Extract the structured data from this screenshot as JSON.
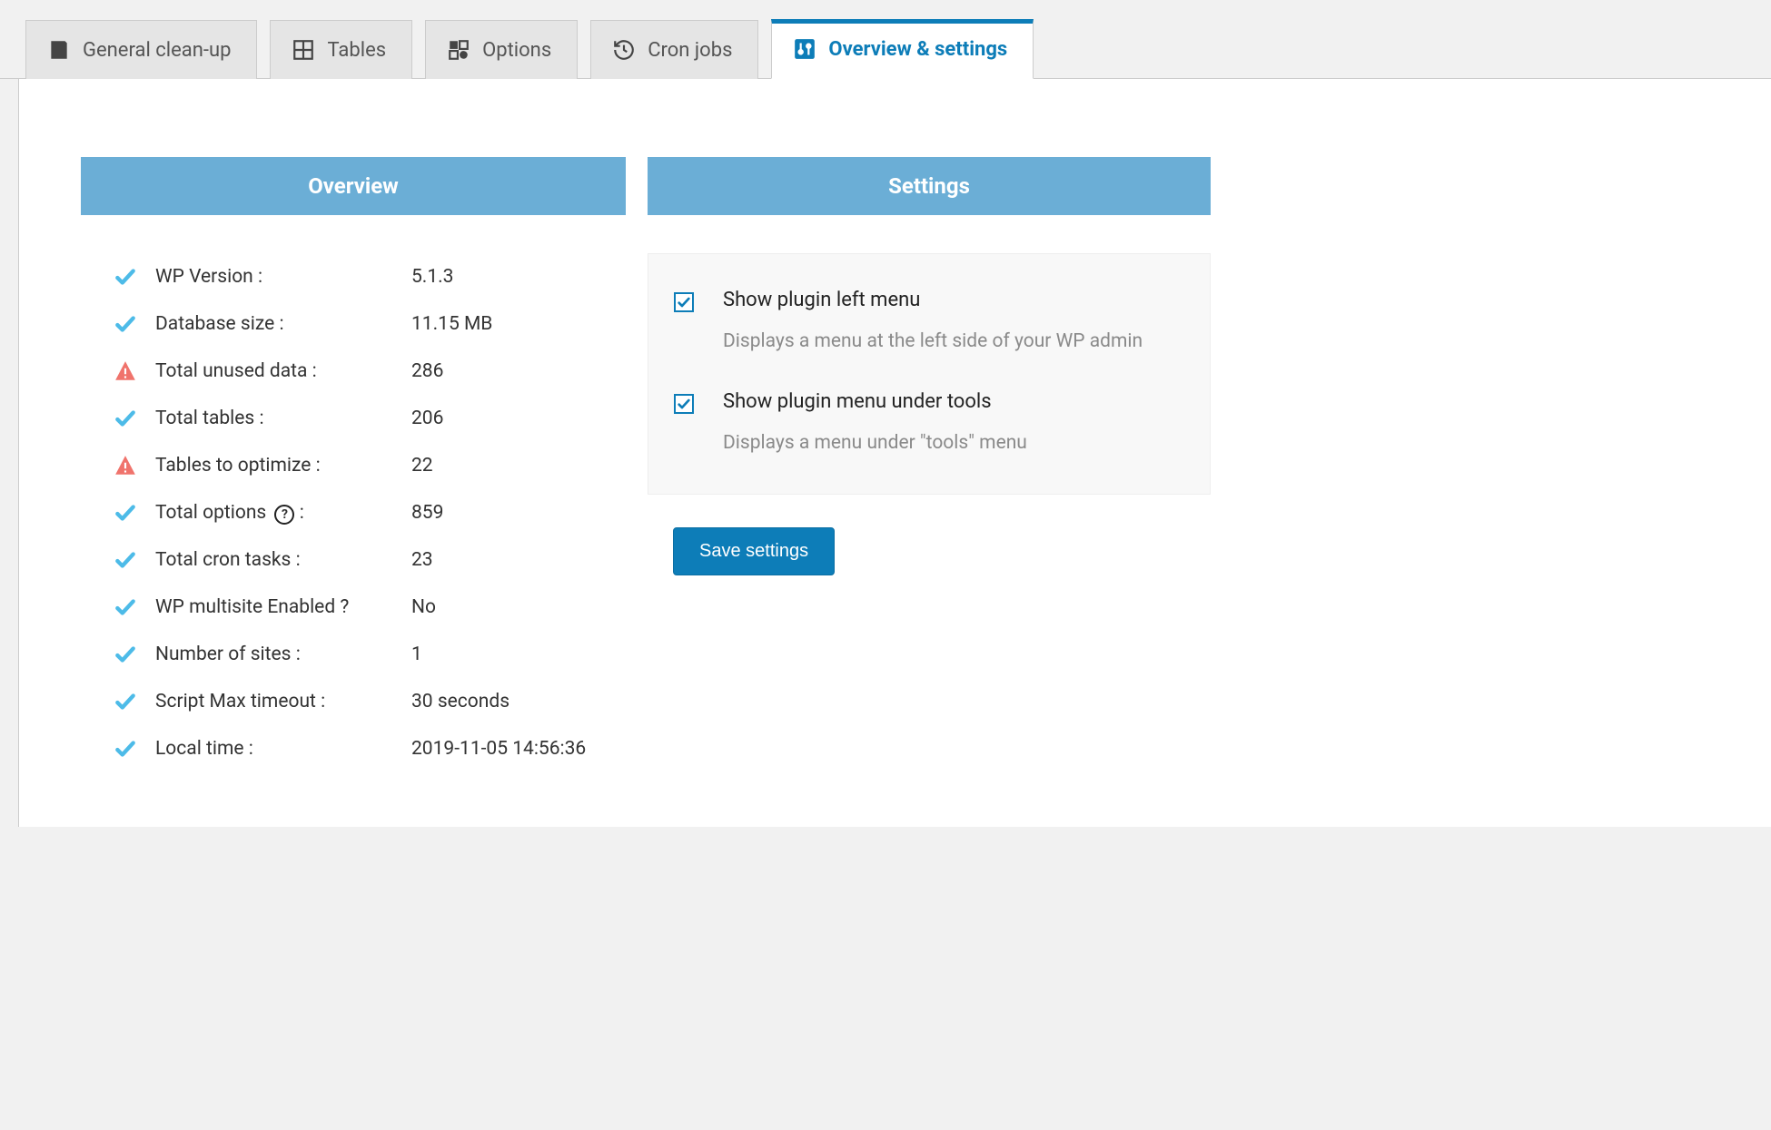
{
  "tabs": [
    {
      "label": "General clean-up"
    },
    {
      "label": "Tables"
    },
    {
      "label": "Options"
    },
    {
      "label": "Cron jobs"
    },
    {
      "label": "Overview & settings"
    }
  ],
  "overview": {
    "title": "Overview",
    "rows": [
      {
        "status": "ok",
        "label": "WP Version :",
        "value": "5.1.3"
      },
      {
        "status": "ok",
        "label": "Database size :",
        "value": "11.15 MB"
      },
      {
        "status": "warn",
        "label": "Total unused data :",
        "value": "286"
      },
      {
        "status": "ok",
        "label": "Total tables :",
        "value": "206"
      },
      {
        "status": "warn",
        "label": "Tables to optimize :",
        "value": "22"
      },
      {
        "status": "ok",
        "label": "Total options",
        "help": true,
        "label_suffix": " :",
        "value": "859"
      },
      {
        "status": "ok",
        "label": "Total cron tasks :",
        "value": "23"
      },
      {
        "status": "ok",
        "label": "WP multisite Enabled ?",
        "value": "No"
      },
      {
        "status": "ok",
        "label": "Number of sites :",
        "value": "1"
      },
      {
        "status": "ok",
        "label": "Script Max timeout :",
        "value": "30 seconds"
      },
      {
        "status": "ok",
        "label": "Local time :",
        "value": "2019-11-05 14:56:36"
      }
    ]
  },
  "settings": {
    "title": "Settings",
    "items": [
      {
        "checked": true,
        "title": "Show plugin left menu",
        "desc": "Displays a menu at the left side of your WP admin"
      },
      {
        "checked": true,
        "title": "Show plugin menu under tools",
        "desc": "Displays a menu under \"tools\" menu"
      }
    ],
    "save_label": "Save settings"
  }
}
